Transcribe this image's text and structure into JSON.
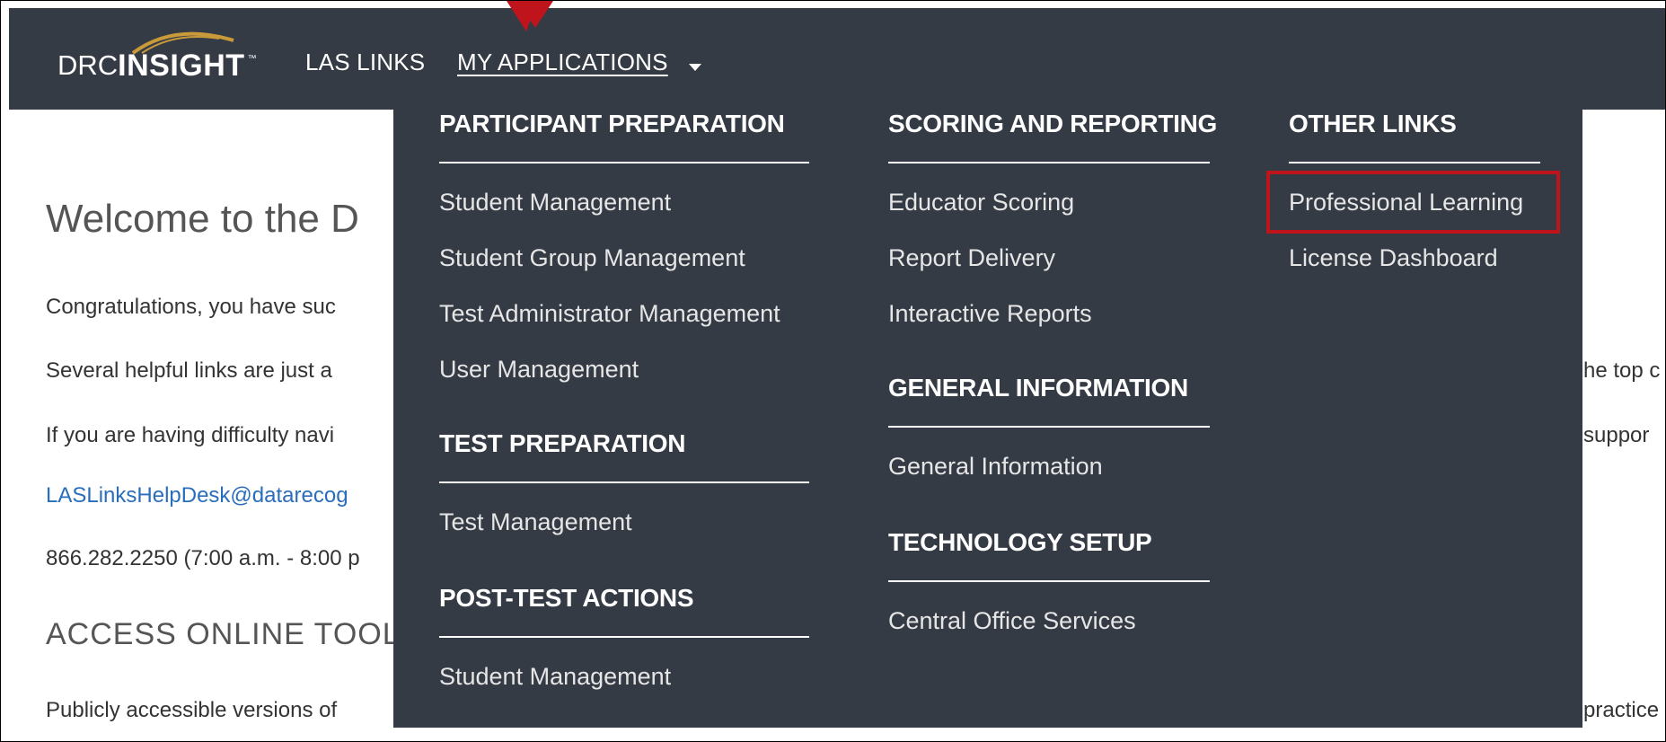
{
  "header": {
    "logo": {
      "drc": "DRC",
      "insight": "INSIGHT",
      "tm": "™"
    },
    "nav": [
      {
        "label": "LAS LINKS"
      },
      {
        "label": "MY APPLICATIONS "
      }
    ]
  },
  "page": {
    "welcome": "Welcome to the D",
    "lines": [
      "Congratulations, you have suc",
      "Several helpful links are just a",
      "If you are having difficulty navi"
    ],
    "email": "LASLinksHelpDesk@datarecog",
    "phone": "866.282.2250 (7:00 a.m. - 8:00 p",
    "access_heading": "ACCESS ONLINE TOOL",
    "public_line": "Publicly accessible versions of",
    "right_fragments": [
      "he top c",
      "suppor",
      "practice"
    ]
  },
  "menu": {
    "participant_preparation": {
      "heading": "PARTICIPANT PREPARATION",
      "items": [
        "Student Management",
        "Student Group Management",
        "Test Administrator Management",
        "User Management"
      ]
    },
    "test_preparation": {
      "heading": "TEST PREPARATION",
      "items": [
        "Test Management"
      ]
    },
    "post_test_actions": {
      "heading": "POST-TEST ACTIONS",
      "items": [
        "Student Management"
      ]
    },
    "scoring_and_reporting": {
      "heading": "SCORING AND REPORTING",
      "items": [
        "Educator Scoring",
        "Report Delivery",
        "Interactive Reports"
      ]
    },
    "general_information": {
      "heading": "GENERAL INFORMATION",
      "items": [
        "General Information"
      ]
    },
    "technology_setup": {
      "heading": "TECHNOLOGY SETUP",
      "items": [
        "Central Office Services"
      ]
    },
    "other_links": {
      "heading": "OTHER LINKS",
      "items": [
        "Professional Learning",
        "License Dashboard"
      ]
    }
  },
  "colors": {
    "navbar": "#353b45",
    "menu": "#353b45",
    "highlight": "#c0141c",
    "link": "#2a6ebb"
  }
}
